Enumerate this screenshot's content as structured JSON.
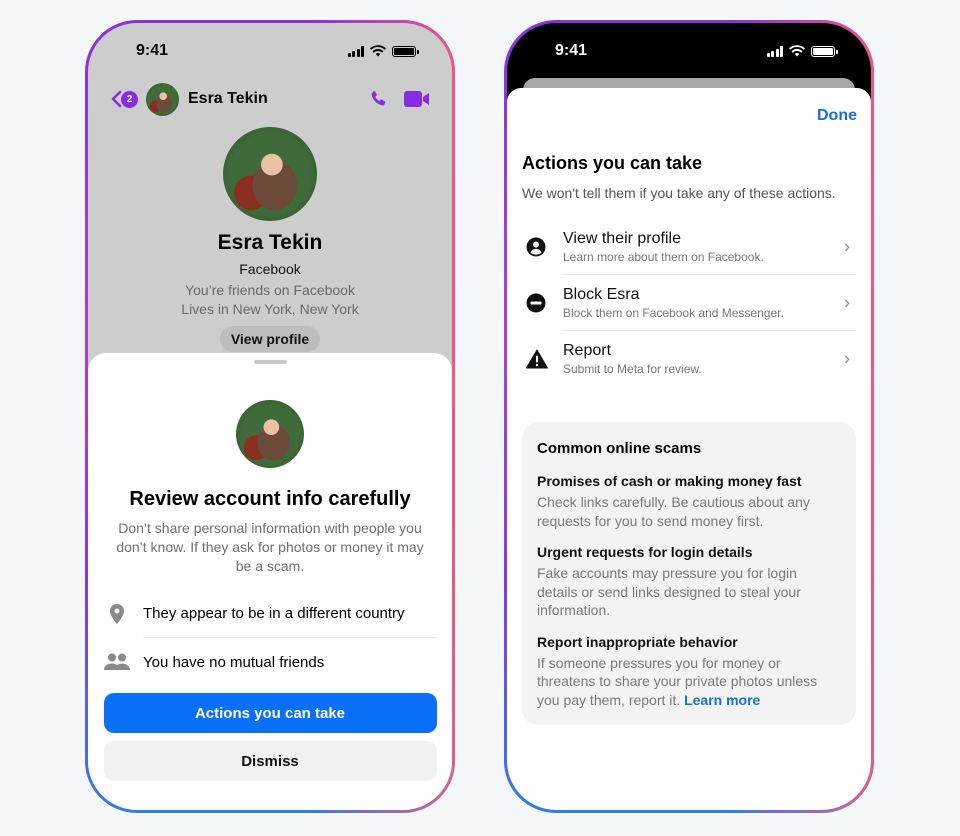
{
  "left_phone": {
    "status_bar": {
      "time": "9:41"
    },
    "header": {
      "unread_count": "2",
      "contact_name": "Esra Tekin"
    },
    "profile": {
      "name": "Esra Tekin",
      "source": "Facebook",
      "friend_status": "You’re friends on Facebook",
      "location": "Lives in New York, New York",
      "view_profile_label": "View profile"
    },
    "sheet": {
      "title": "Review account info carefully",
      "description": "Don’t share personal information with people you don’t know. If they ask for photos or money it may be a scam.",
      "info_items": [
        {
          "icon": "location-pin-icon",
          "text": "They appear to be in a different country"
        },
        {
          "icon": "people-icon",
          "text": "You have no mutual friends"
        }
      ],
      "primary_button": "Actions you can take",
      "secondary_button": "Dismiss"
    }
  },
  "right_phone": {
    "status_bar": {
      "time": "9:41"
    },
    "done_label": "Done",
    "title": "Actions you can take",
    "subtitle": "We won't tell them if you take any of these actions.",
    "actions": [
      {
        "icon": "person-circle-icon",
        "title": "View their profile",
        "subtitle": "Learn more about them on Facebook."
      },
      {
        "icon": "block-icon",
        "title": "Block Esra",
        "subtitle": "Block them on Facebook and Messenger."
      },
      {
        "icon": "warning-icon",
        "title": "Report",
        "subtitle": "Submit to Meta for review."
      }
    ],
    "scams": {
      "heading": "Common online scams",
      "items": [
        {
          "title": "Promises of cash or making money fast",
          "body": "Check links carefully. Be cautious about any requests for you to send money first."
        },
        {
          "title": "Urgent requests for login details",
          "body": "Fake accounts may pressure you for login details or send links designed to steal your information."
        },
        {
          "title": "Report inappropriate behavior",
          "body": "If someone pressures you for money or threatens to share your private photos unless you pay them, report it.",
          "link": "Learn more"
        }
      ]
    }
  },
  "colors": {
    "accent_purple": "#8a2be2",
    "primary_blue": "#0a70f5",
    "link_blue": "#1a6fd6"
  }
}
